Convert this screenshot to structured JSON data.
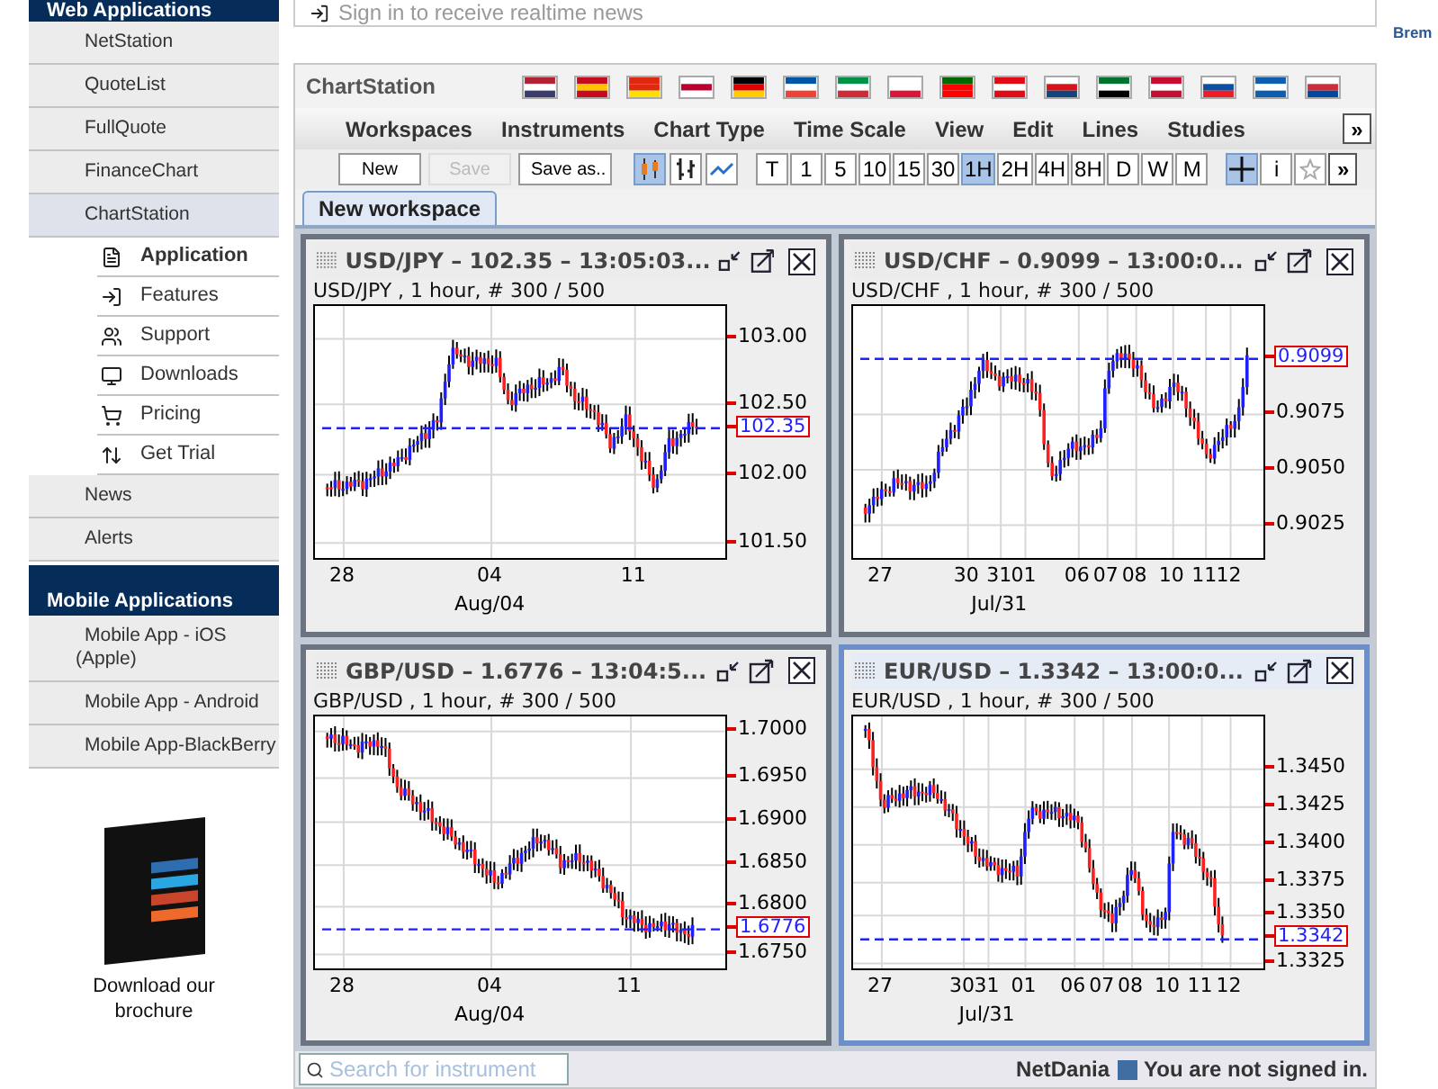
{
  "sidebar": {
    "sections": [
      {
        "title": "Web Applications",
        "items": [
          {
            "label": "NetStation",
            "selected": false
          },
          {
            "label": "QuoteList",
            "selected": false
          },
          {
            "label": "FullQuote",
            "selected": false
          },
          {
            "label": "FinanceChart",
            "selected": false
          },
          {
            "label": "ChartStation",
            "selected": true,
            "children": [
              {
                "label": "Application",
                "selected": true
              },
              {
                "label": "Features",
                "selected": false
              },
              {
                "label": "Support",
                "selected": false
              },
              {
                "label": "Downloads",
                "selected": false
              },
              {
                "label": "Pricing",
                "selected": false
              },
              {
                "label": "Get Trial",
                "selected": false
              }
            ]
          },
          {
            "label": "News",
            "selected": false
          },
          {
            "label": "Alerts",
            "selected": false
          }
        ]
      },
      {
        "title": "Mobile Applications",
        "items": [
          {
            "label": "Mobile App - iOS (Apple)",
            "selected": false
          },
          {
            "label": "Mobile App - Android",
            "selected": false
          },
          {
            "label": "Mobile App-BlackBerry",
            "selected": false
          }
        ]
      }
    ],
    "brochure": "Download our brochure"
  },
  "signin": "Sign in to receive realtime news",
  "right_column": "Brem",
  "app": {
    "title": "ChartStation",
    "menu": [
      "Workspaces",
      "Instruments",
      "Chart Type",
      "Time Scale",
      "View",
      "Edit",
      "Lines",
      "Studies"
    ],
    "menu_more": "»",
    "buttons": [
      {
        "label": "New",
        "disabled": false
      },
      {
        "label": "Save",
        "disabled": true
      },
      {
        "label": "Save as..",
        "disabled": false
      }
    ],
    "chart_types": [
      {
        "kind": "candle",
        "selected": true
      },
      {
        "kind": "bar",
        "selected": false
      },
      {
        "kind": "line",
        "selected": false
      }
    ],
    "timescales": [
      {
        "label": "T",
        "selected": false
      },
      {
        "label": "1",
        "selected": false
      },
      {
        "label": "5",
        "selected": false
      },
      {
        "label": "10",
        "selected": false
      },
      {
        "label": "15",
        "selected": false
      },
      {
        "label": "30",
        "selected": false
      },
      {
        "label": "1H",
        "selected": true
      },
      {
        "label": "2H",
        "selected": false
      },
      {
        "label": "4H",
        "selected": false
      },
      {
        "label": "8H",
        "selected": false
      },
      {
        "label": "D",
        "selected": false
      },
      {
        "label": "W",
        "selected": false
      },
      {
        "label": "M",
        "selected": false
      }
    ],
    "tools": [
      {
        "kind": "crosshair",
        "selected": true
      },
      {
        "kind": "text",
        "label": "i",
        "selected": false
      },
      {
        "kind": "pin",
        "selected": false
      }
    ],
    "tools_more": "»",
    "tabs": [
      {
        "label": "New workspace",
        "selected": true
      }
    ],
    "windows": [
      {
        "title": "USD/JPY – 102.35 – 13:05:03...",
        "subtitle": "USD/JPY , 1 hour, # 300 / 500",
        "active": false,
        "y_ticks": [
          "103.00",
          "102.50",
          "102.00",
          "101.50"
        ],
        "last_price": "102.35",
        "x_ticks": [
          "28",
          "04",
          "11"
        ],
        "x_period": "Aug/04"
      },
      {
        "title": "USD/CHF – 0.9099 – 13:00:0...",
        "subtitle": "USD/CHF , 1 hour, # 300 / 500",
        "active": false,
        "y_ticks": [
          "0.9075",
          "0.9050",
          "0.9025"
        ],
        "last_price": "0.9099",
        "x_ticks": [
          "27",
          "30",
          "31",
          "01",
          "06",
          "07",
          "08",
          "10",
          "11",
          "12"
        ],
        "x_period": "Jul/31"
      },
      {
        "title": "GBP/USD – 1.6776 – 13:04:5...",
        "subtitle": "GBP/USD , 1 hour, # 300 / 500",
        "active": false,
        "y_ticks": [
          "1.7000",
          "1.6950",
          "1.6900",
          "1.6850",
          "1.6800",
          "1.6750"
        ],
        "last_price": "1.6776",
        "x_ticks": [
          "28",
          "04",
          "11"
        ],
        "x_period": "Aug/04"
      },
      {
        "title": "EUR/USD – 1.3342 – 13:00:0...",
        "subtitle": "EUR/USD , 1 hour, # 300 / 500",
        "active": true,
        "y_ticks": [
          "1.3450",
          "1.3425",
          "1.3400",
          "1.3375",
          "1.3350",
          "1.3325"
        ],
        "last_price": "1.3342",
        "x_ticks": [
          "27",
          "30",
          "31",
          "01",
          "06",
          "07",
          "08",
          "10",
          "11",
          "12"
        ],
        "x_period": "Jul/31"
      }
    ],
    "status": {
      "search_placeholder": "Search for instrument",
      "brand": "NetDania",
      "message": "You are not signed in."
    }
  }
}
